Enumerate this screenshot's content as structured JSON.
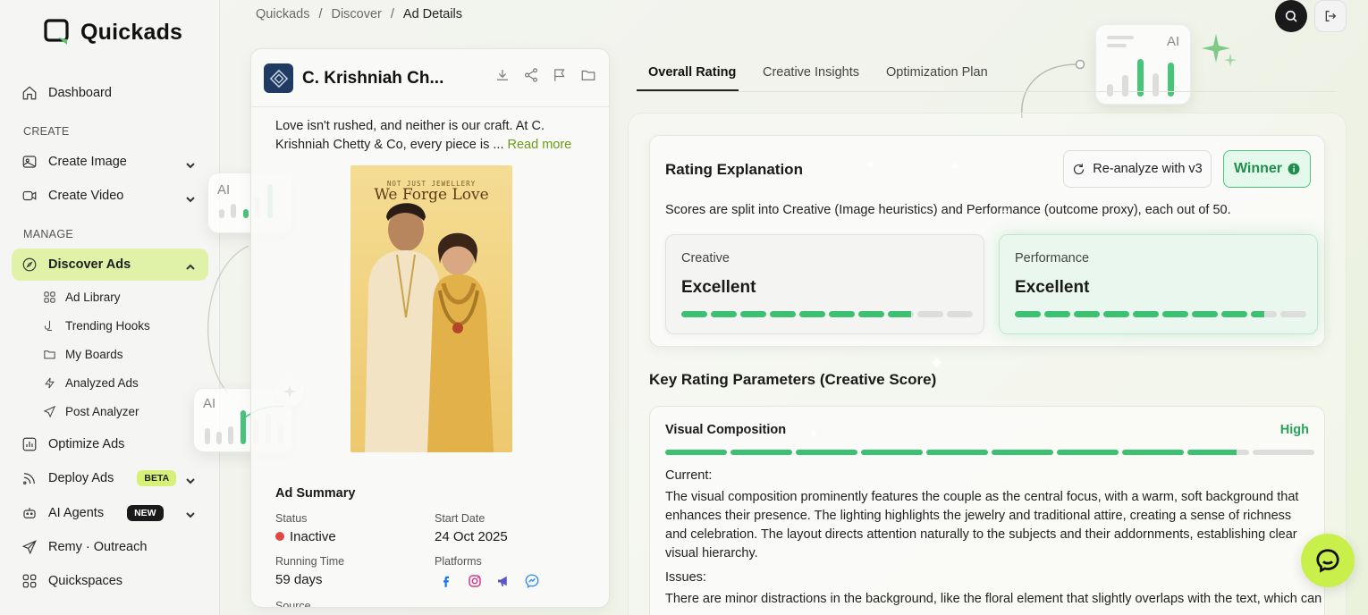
{
  "app": {
    "name": "Quickads"
  },
  "breadcrumb": [
    "Quickads",
    "Discover",
    "Ad Details"
  ],
  "sidebar": {
    "dashboard": "Dashboard",
    "create_label": "CREATE",
    "create_image": "Create Image",
    "create_video": "Create Video",
    "manage_label": "MANAGE",
    "discover_ads": "Discover Ads",
    "sub": [
      "Ad Library",
      "Trending Hooks",
      "My Boards",
      "Analyzed Ads",
      "Post Analyzer"
    ],
    "optimize_ads": "Optimize Ads",
    "deploy_ads": "Deploy Ads",
    "deploy_badge": "BETA",
    "ai_agents": "AI Agents",
    "ai_badge": "NEW",
    "remy": "Remy · Outreach",
    "quickspaces": "Quickspaces"
  },
  "ai_cards": {
    "label": "AI"
  },
  "ad": {
    "title": "C. Krishniah Ch...",
    "text": "Love isn't rushed, and neither is our craft. At C. Krishniah Chetty & Co, every piece is ... ",
    "read_more": "Read more",
    "image_tagline": "NOT JUST JEWELLERY",
    "image_headline": "We Forge Love",
    "summary_title": "Ad Summary",
    "status_label": "Status",
    "status_value": "Inactive",
    "start_label": "Start Date",
    "start_value": "24 Oct 2025",
    "running_label": "Running Time",
    "running_value": "59 days",
    "platforms_label": "Platforms",
    "platforms": [
      "facebook-icon",
      "instagram-icon",
      "audience-network-icon",
      "messenger-icon"
    ],
    "source_label": "Source"
  },
  "tabs": [
    "Overall Rating",
    "Creative Insights",
    "Optimization Plan"
  ],
  "rating": {
    "title": "Rating Explanation",
    "reanalyze": "Re-analyze with v3",
    "winner": "Winner",
    "desc": "Scores are split into Creative (Image heuristics) and Performance (outcome proxy), each out of 50.",
    "creative_label": "Creative",
    "creative_value": "Excellent",
    "creative_level": 0.79,
    "performance_label": "Performance",
    "performance_value": "Excellent",
    "performance_level": 0.85
  },
  "key_params_title": "Key Rating Parameters (Creative Score)",
  "visual": {
    "title": "Visual Composition",
    "level_label": "High",
    "level": 0.88,
    "current_label": "Current:",
    "current_text": "The visual composition prominently features the couple as the central focus, with a warm, soft background that enhances their presence. The lighting highlights the jewelry and traditional attire, creating a sense of richness and celebration. The layout directs attention naturally to the subjects and their addornments, establishing clear visual hierarchy.",
    "issues_label": "Issues:",
    "issues_text": "There are minor distractions in the background, like the floral element that slightly overlaps with the text, which can"
  },
  "colors": {
    "accent": "#dff2a8",
    "green": "#3cc071",
    "chat": "#c9f04a"
  }
}
